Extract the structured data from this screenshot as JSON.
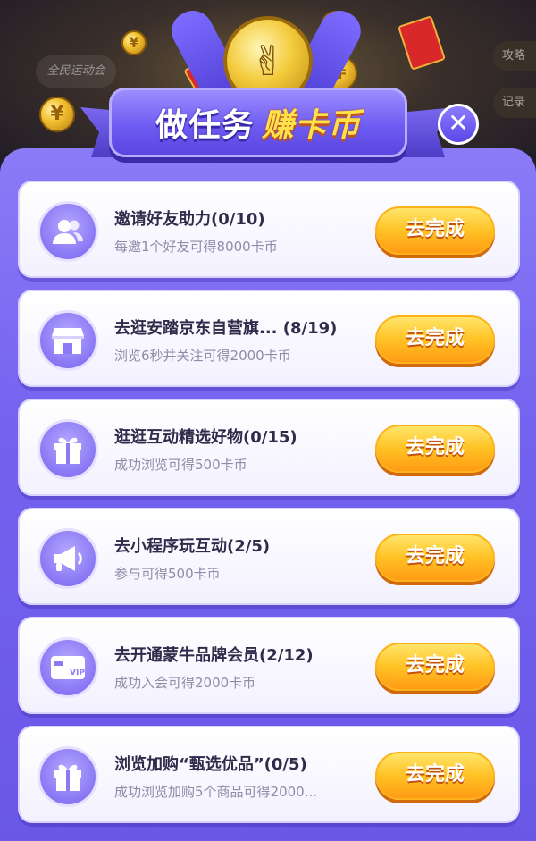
{
  "header": {
    "title_part1": "做任务",
    "title_part2": "赚卡币",
    "close_symbol": "✕"
  },
  "background": {
    "logo_text": "全民运动会",
    "side_buttons": [
      "攻略",
      "记录"
    ]
  },
  "tasks": [
    {
      "title": "邀请好友助力(0/10)",
      "desc": "每邀1个好友可得8000卡币",
      "button": "去完成",
      "icon": "users-icon"
    },
    {
      "title": "去逛安踏京东自营旗... (8/19)",
      "desc": "浏览6秒并关注可得2000卡币",
      "button": "去完成",
      "icon": "store-icon"
    },
    {
      "title": "逛逛互动精选好物(0/15)",
      "desc": "成功浏览可得500卡币",
      "button": "去完成",
      "icon": "gift-icon"
    },
    {
      "title": "去小程序玩互动(2/5)",
      "desc": "参与可得500卡币",
      "button": "去完成",
      "icon": "megaphone-icon"
    },
    {
      "title": "去开通蒙牛品牌会员(2/12)",
      "desc": "成功入会可得2000卡币",
      "button": "去完成",
      "icon": "vip-card-icon"
    },
    {
      "title": "浏览加购“甄选优品”(0/5)",
      "desc": "成功浏览加购5个商品可得2000...",
      "button": "去完成",
      "icon": "gift-icon"
    }
  ]
}
